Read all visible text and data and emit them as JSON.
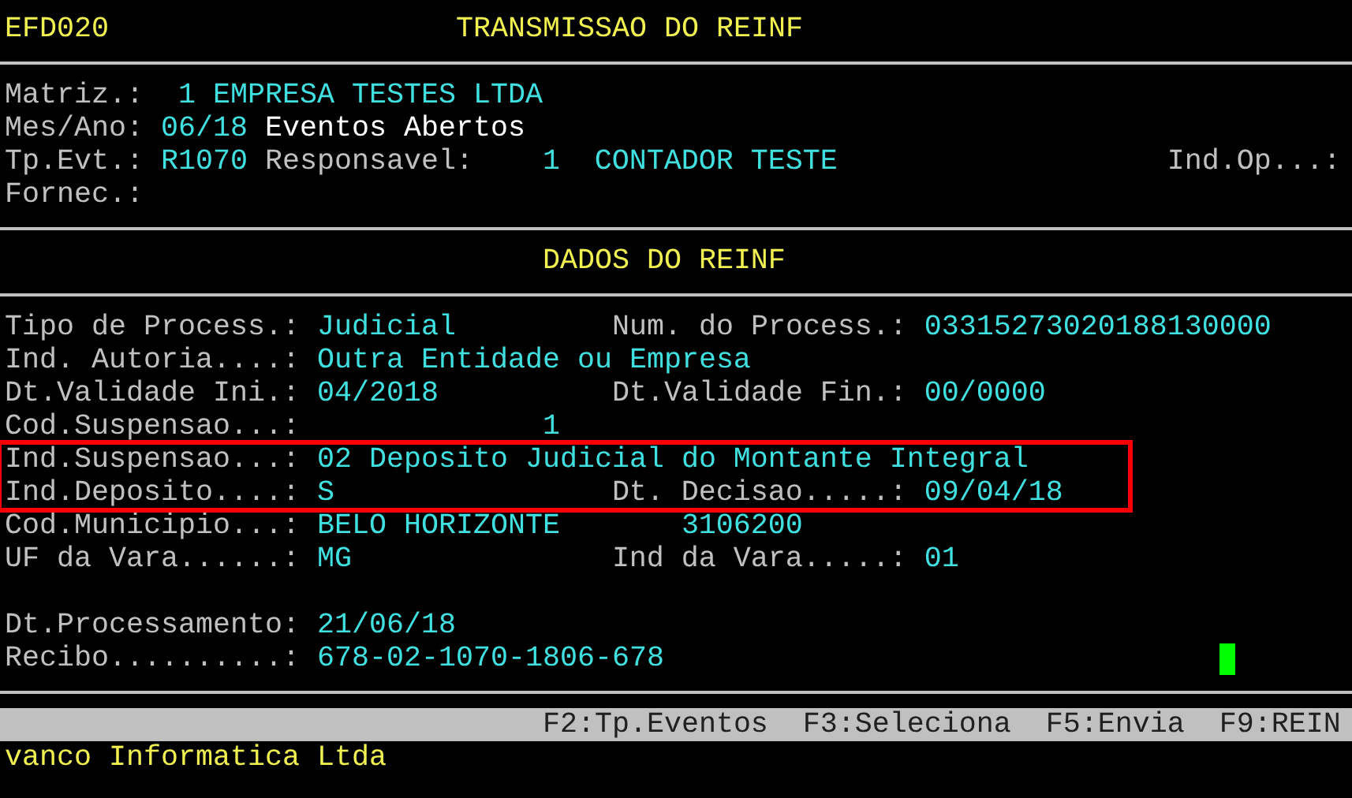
{
  "header": {
    "program": "EFD020",
    "title": "TRANSMISSAO DO REINF"
  },
  "info_rows": [
    {
      "segments": [
        {
          "kind": "label",
          "text": "Matriz.:"
        },
        {
          "kind": "value",
          "text": "1 EMPRESA TESTES LTDA"
        }
      ]
    },
    {
      "segments": [
        {
          "kind": "label",
          "text": "Mes/Ano:"
        },
        {
          "kind": "value",
          "text": "06/18"
        },
        {
          "kind": "note",
          "text": "Eventos Abertos"
        }
      ]
    },
    {
      "segments": [
        {
          "kind": "label",
          "text": "Tp.Evt.:"
        },
        {
          "kind": "value",
          "text": "R1070"
        },
        {
          "kind": "label",
          "text": "Responsavel:"
        },
        {
          "kind": "value",
          "text": "1"
        },
        {
          "kind": "value",
          "text": "CONTADOR TESTE"
        },
        {
          "kind": "label",
          "text": "Ind.Op...:"
        }
      ]
    },
    {
      "segments": [
        {
          "kind": "label",
          "text": "Fornec.:"
        }
      ]
    }
  ],
  "section_title": "DADOS DO REINF",
  "data_rows": [
    {
      "highlighted": false,
      "segments": [
        {
          "kind": "label",
          "text": "Tipo de Process.:"
        },
        {
          "kind": "value",
          "text": "Judicial"
        },
        {
          "kind": "label",
          "text": "Num. do Process.:"
        },
        {
          "kind": "value",
          "text": "03315273020188130000"
        }
      ]
    },
    {
      "highlighted": false,
      "segments": [
        {
          "kind": "label",
          "text": "Ind. Autoria....:"
        },
        {
          "kind": "value",
          "text": "Outra Entidade ou Empresa"
        }
      ]
    },
    {
      "highlighted": false,
      "segments": [
        {
          "kind": "label",
          "text": "Dt.Validade Ini.:"
        },
        {
          "kind": "value",
          "text": "04/2018"
        },
        {
          "kind": "label",
          "text": "Dt.Validade Fin.:"
        },
        {
          "kind": "value",
          "text": "00/0000"
        }
      ]
    },
    {
      "highlighted": false,
      "segments": [
        {
          "kind": "label",
          "text": "Cod.Suspensao...:"
        },
        {
          "kind": "value",
          "text": "1"
        }
      ]
    },
    {
      "highlighted": true,
      "segments": [
        {
          "kind": "label",
          "text": "Ind.Suspensao...:"
        },
        {
          "kind": "value",
          "text": "02 Deposito Judicial do Montante Integral"
        }
      ]
    },
    {
      "highlighted": true,
      "segments": [
        {
          "kind": "label",
          "text": "Ind.Deposito....:"
        },
        {
          "kind": "value",
          "text": "S"
        },
        {
          "kind": "label",
          "text": "Dt. Decisao.....:"
        },
        {
          "kind": "value",
          "text": "09/04/18"
        }
      ]
    },
    {
      "highlighted": false,
      "segments": [
        {
          "kind": "label",
          "text": "Cod.Municipio...:"
        },
        {
          "kind": "value",
          "text": "BELO HORIZONTE"
        },
        {
          "kind": "value",
          "text": "3106200"
        }
      ]
    },
    {
      "highlighted": false,
      "segments": [
        {
          "kind": "label",
          "text": "UF da Vara......:"
        },
        {
          "kind": "value",
          "text": "MG"
        },
        {
          "kind": "label",
          "text": "Ind da Vara.....:"
        },
        {
          "kind": "value",
          "text": "01"
        }
      ]
    }
  ],
  "footer_rows": [
    {
      "segments": [
        {
          "kind": "label",
          "text": "Dt.Processamento:"
        },
        {
          "kind": "value",
          "text": "21/06/18"
        }
      ]
    },
    {
      "segments": [
        {
          "kind": "label",
          "text": "Recibo..........:"
        },
        {
          "kind": "value",
          "text": "678-02-1070-1806-678"
        }
      ]
    }
  ],
  "cursor": {
    "shown": true
  },
  "function_keys": [
    "F2:Tp.Eventos",
    "F3:Seleciona",
    "F5:Envia",
    "F9:REIN"
  ],
  "company": "vanco Informatica Ltda"
}
